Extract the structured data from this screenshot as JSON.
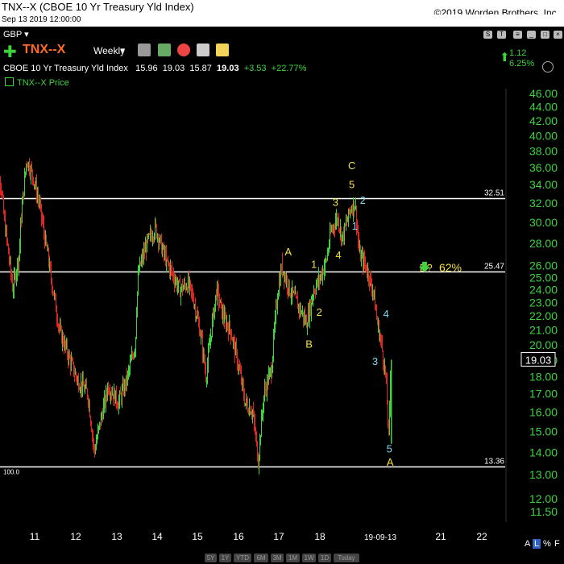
{
  "header": {
    "title": "TNX--X (CBOE 10 Yr Treasury Yld Index)",
    "copyright": "©2019 Worden Brothers, Inc.",
    "datetime": "Sep 13 2019 12:00:00"
  },
  "toolbar": {
    "currency": "GBP",
    "currency_caret": "▾",
    "symbol": "TNX--X",
    "period": "Weekly",
    "period_caret": "▾",
    "change_abs": "1.12",
    "change_pct": "6.25%"
  },
  "quote": {
    "name": "CBOE 10 Yr Treasury Yld Index",
    "open": "15.96",
    "high": "19.03",
    "low": "15.87",
    "close": "19.03",
    "change": "+3.53",
    "change_pct": "+22.77%"
  },
  "legend": {
    "label": "TNX--X Price"
  },
  "bottom_buttons": [
    "5Y",
    "1Y",
    "YTD",
    "6M",
    "3M",
    "1M",
    "1W",
    "1D",
    "Today"
  ],
  "axis_flags": [
    "A",
    "L",
    "%",
    "F"
  ],
  "colors": {
    "up": "#3fd43f",
    "down": "#e02424",
    "wave_yellow": "#f0e040",
    "wave_cyan": "#7fd9f2",
    "hline": "#ffffff",
    "axis_text": "#3fd43f"
  },
  "chart_data": {
    "type": "candlestick",
    "y_scale": "log",
    "ylim": [
      11.5,
      46.0
    ],
    "y_ticks": [
      46.0,
      44.0,
      42.0,
      40.0,
      38.0,
      36.0,
      34.0,
      32.0,
      30.0,
      28.0,
      26.0,
      25.0,
      24.0,
      23.0,
      22.0,
      21.0,
      20.0,
      19.0,
      18.0,
      17.0,
      16.0,
      15.0,
      14.0,
      13.0,
      12.0,
      11.5
    ],
    "y_tick_labels": [
      "46.00",
      "44.00",
      "42.00",
      "40.00",
      "38.00",
      "36.00",
      "34.00",
      "32.00",
      "30.00",
      "28.00",
      "26.00",
      "25.00",
      "24.00",
      "23.00",
      "22.00",
      "21.00",
      "20.00",
      "19.00",
      "18.00",
      "17.00",
      "16.00",
      "15.00",
      "14.00",
      "13.00",
      "12.00",
      "11.50"
    ],
    "x_ticks": [
      "11",
      "12",
      "13",
      "14",
      "15",
      "16",
      "17",
      "18",
      "19-09-13",
      "21",
      "22"
    ],
    "last_price_label": "19.03",
    "hlines": [
      {
        "value": 32.51,
        "label": "32.51"
      },
      {
        "value": 25.47,
        "label": "25.47"
      },
      {
        "value": 13.36,
        "label": "13.36",
        "left_label": "100.0"
      }
    ],
    "waypoints": [
      [
        2010.0,
        39.8
      ],
      [
        2010.12,
        36.0
      ],
      [
        2010.25,
        30.0
      ],
      [
        2010.35,
        27.0
      ],
      [
        2010.45,
        24.0
      ],
      [
        2010.6,
        27.0
      ],
      [
        2010.8,
        37.0
      ],
      [
        2010.95,
        35.0
      ],
      [
        2011.1,
        32.0
      ],
      [
        2011.25,
        28.0
      ],
      [
        2011.6,
        21.0
      ],
      [
        2011.85,
        19.0
      ],
      [
        2012.0,
        18.0
      ],
      [
        2012.3,
        17.0
      ],
      [
        2012.45,
        14.0
      ],
      [
        2012.6,
        15.5
      ],
      [
        2012.8,
        17.5
      ],
      [
        2013.05,
        16.5
      ],
      [
        2013.25,
        17.8
      ],
      [
        2013.45,
        20.0
      ],
      [
        2013.55,
        25.5
      ],
      [
        2013.75,
        28.0
      ],
      [
        2013.95,
        29.5
      ],
      [
        2014.15,
        27.0
      ],
      [
        2014.35,
        25.5
      ],
      [
        2014.55,
        24.0
      ],
      [
        2014.75,
        24.5
      ],
      [
        2014.9,
        23.0
      ],
      [
        2015.05,
        21.0
      ],
      [
        2015.2,
        18.0
      ],
      [
        2015.45,
        24.0
      ],
      [
        2015.6,
        22.0
      ],
      [
        2015.8,
        21.0
      ],
      [
        2016.0,
        18.5
      ],
      [
        2016.15,
        16.5
      ],
      [
        2016.35,
        16.0
      ],
      [
        2016.48,
        13.6
      ],
      [
        2016.62,
        17.0
      ],
      [
        2016.8,
        18.5
      ],
      [
        2016.95,
        24.0
      ],
      [
        2017.05,
        26.0
      ],
      [
        2017.25,
        24.0
      ],
      [
        2017.5,
        22.5
      ],
      [
        2017.65,
        21.5
      ],
      [
        2017.85,
        24.0
      ],
      [
        2018.0,
        25.0
      ],
      [
        2018.15,
        26.5
      ],
      [
        2018.25,
        29.0
      ],
      [
        2018.4,
        30.5
      ],
      [
        2018.55,
        28.5
      ],
      [
        2018.75,
        31.5
      ],
      [
        2018.85,
        32.0
      ],
      [
        2018.95,
        27.0
      ],
      [
        2019.1,
        26.0
      ],
      [
        2019.3,
        24.0
      ],
      [
        2019.4,
        21.5
      ],
      [
        2019.5,
        20.0
      ],
      [
        2019.6,
        18.0
      ],
      [
        2019.68,
        14.5
      ],
      [
        2019.72,
        19.03
      ]
    ],
    "wave_labels": [
      {
        "text": "C",
        "x": 2018.78,
        "y": 35.8,
        "color": "yellow"
      },
      {
        "text": "5",
        "x": 2018.78,
        "y": 33.6,
        "color": "yellow"
      },
      {
        "text": "3",
        "x": 2018.38,
        "y": 31.7,
        "color": "yellow"
      },
      {
        "text": "2",
        "x": 2019.05,
        "y": 31.9,
        "color": "cyan"
      },
      {
        "text": "1",
        "x": 2018.85,
        "y": 29.3,
        "color": "cyan"
      },
      {
        "text": "A",
        "x": 2017.22,
        "y": 26.9,
        "color": "yellow"
      },
      {
        "text": "1",
        "x": 2017.85,
        "y": 25.8,
        "color": "yellow"
      },
      {
        "text": "4",
        "x": 2018.45,
        "y": 26.6,
        "color": "yellow"
      },
      {
        "text": "2",
        "x": 2017.98,
        "y": 22.0,
        "color": "yellow"
      },
      {
        "text": "B",
        "x": 2017.73,
        "y": 19.8,
        "color": "yellow"
      },
      {
        "text": "4",
        "x": 2019.62,
        "y": 21.9,
        "color": "cyan"
      },
      {
        "text": "3",
        "x": 2019.35,
        "y": 18.7,
        "color": "cyan"
      },
      {
        "text": "5",
        "x": 2019.7,
        "y": 14.0,
        "color": "cyan"
      },
      {
        "text": "A",
        "x": 2019.72,
        "y": 13.4,
        "color": "yellow"
      },
      {
        "text": "B?",
        "x": 2020.6,
        "y": 25.5,
        "color": "yellow"
      }
    ],
    "annotation": {
      "text": "62%",
      "x": 2020.92,
      "y": 25.5
    }
  }
}
